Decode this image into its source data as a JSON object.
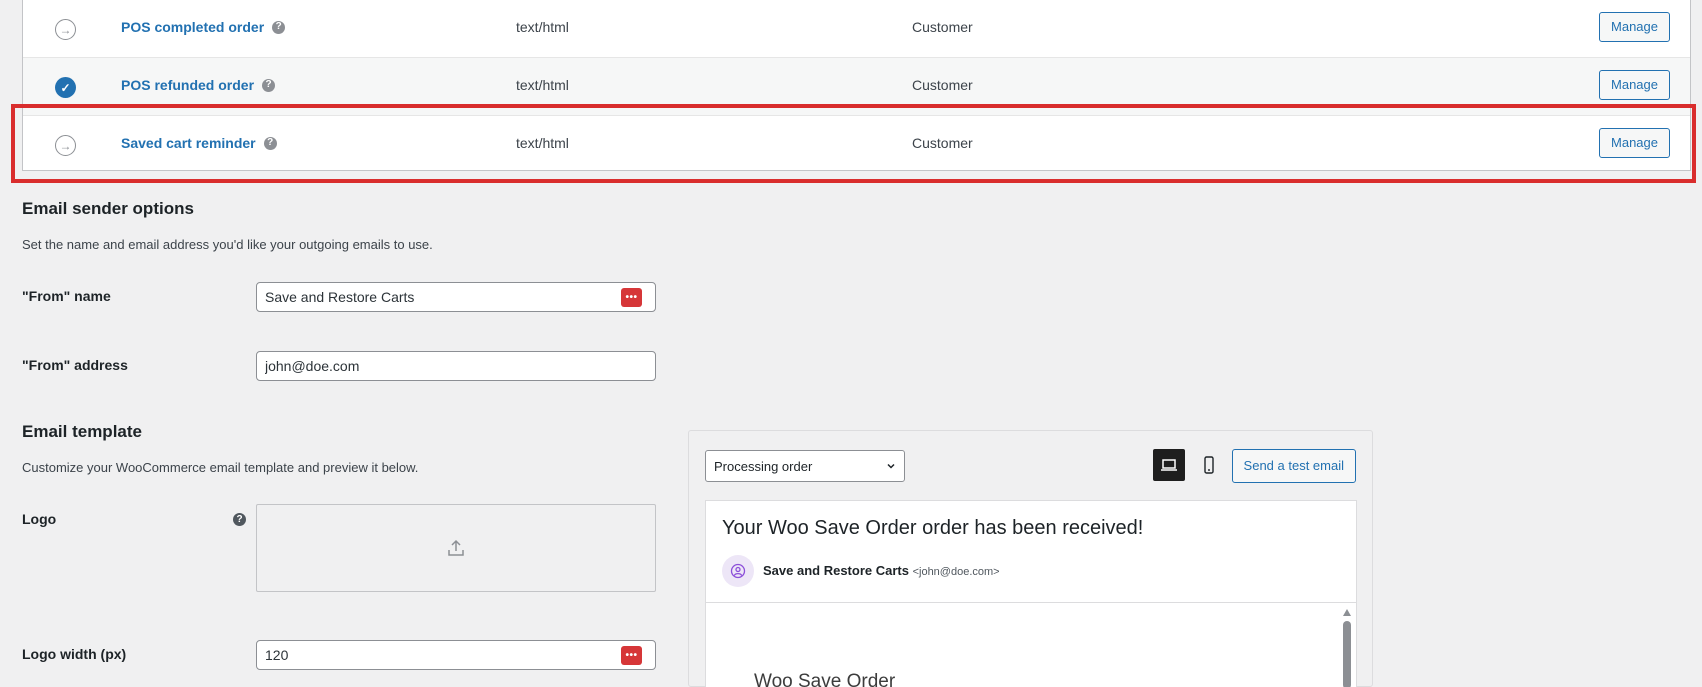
{
  "email_table": {
    "rows": [
      {
        "name": "POS completed order",
        "content_type": "text/html",
        "recipient": "Customer",
        "status": "manual",
        "action": "Manage"
      },
      {
        "name": "POS refunded order",
        "content_type": "text/html",
        "recipient": "Customer",
        "status": "enabled",
        "action": "Manage"
      },
      {
        "name": "Saved cart reminder",
        "content_type": "text/html",
        "recipient": "Customer",
        "status": "manual",
        "action": "Manage"
      }
    ]
  },
  "sender_options": {
    "title": "Email sender options",
    "description": "Set the name and email address you'd like your outgoing emails to use.",
    "from_name_label": "\"From\" name",
    "from_name_value": "Save and Restore Carts",
    "from_address_label": "\"From\" address",
    "from_address_value": "john@doe.com"
  },
  "template": {
    "title": "Email template",
    "description": "Customize your WooCommerce email template and preview it below.",
    "logo_label": "Logo",
    "logo_width_label": "Logo width (px)",
    "logo_width_value": "120"
  },
  "preview": {
    "selected_email": "Processing order",
    "send_test_label": "Send a test email",
    "subject": "Your Woo Save Order order has been received!",
    "sender_name": "Save and Restore Carts",
    "sender_email": "<john@doe.com>",
    "body_heading": "Woo Save Order"
  },
  "colors": {
    "link_blue": "#2271b1",
    "highlight_red": "#d92d2d",
    "password_manager_red": "#d63638"
  }
}
